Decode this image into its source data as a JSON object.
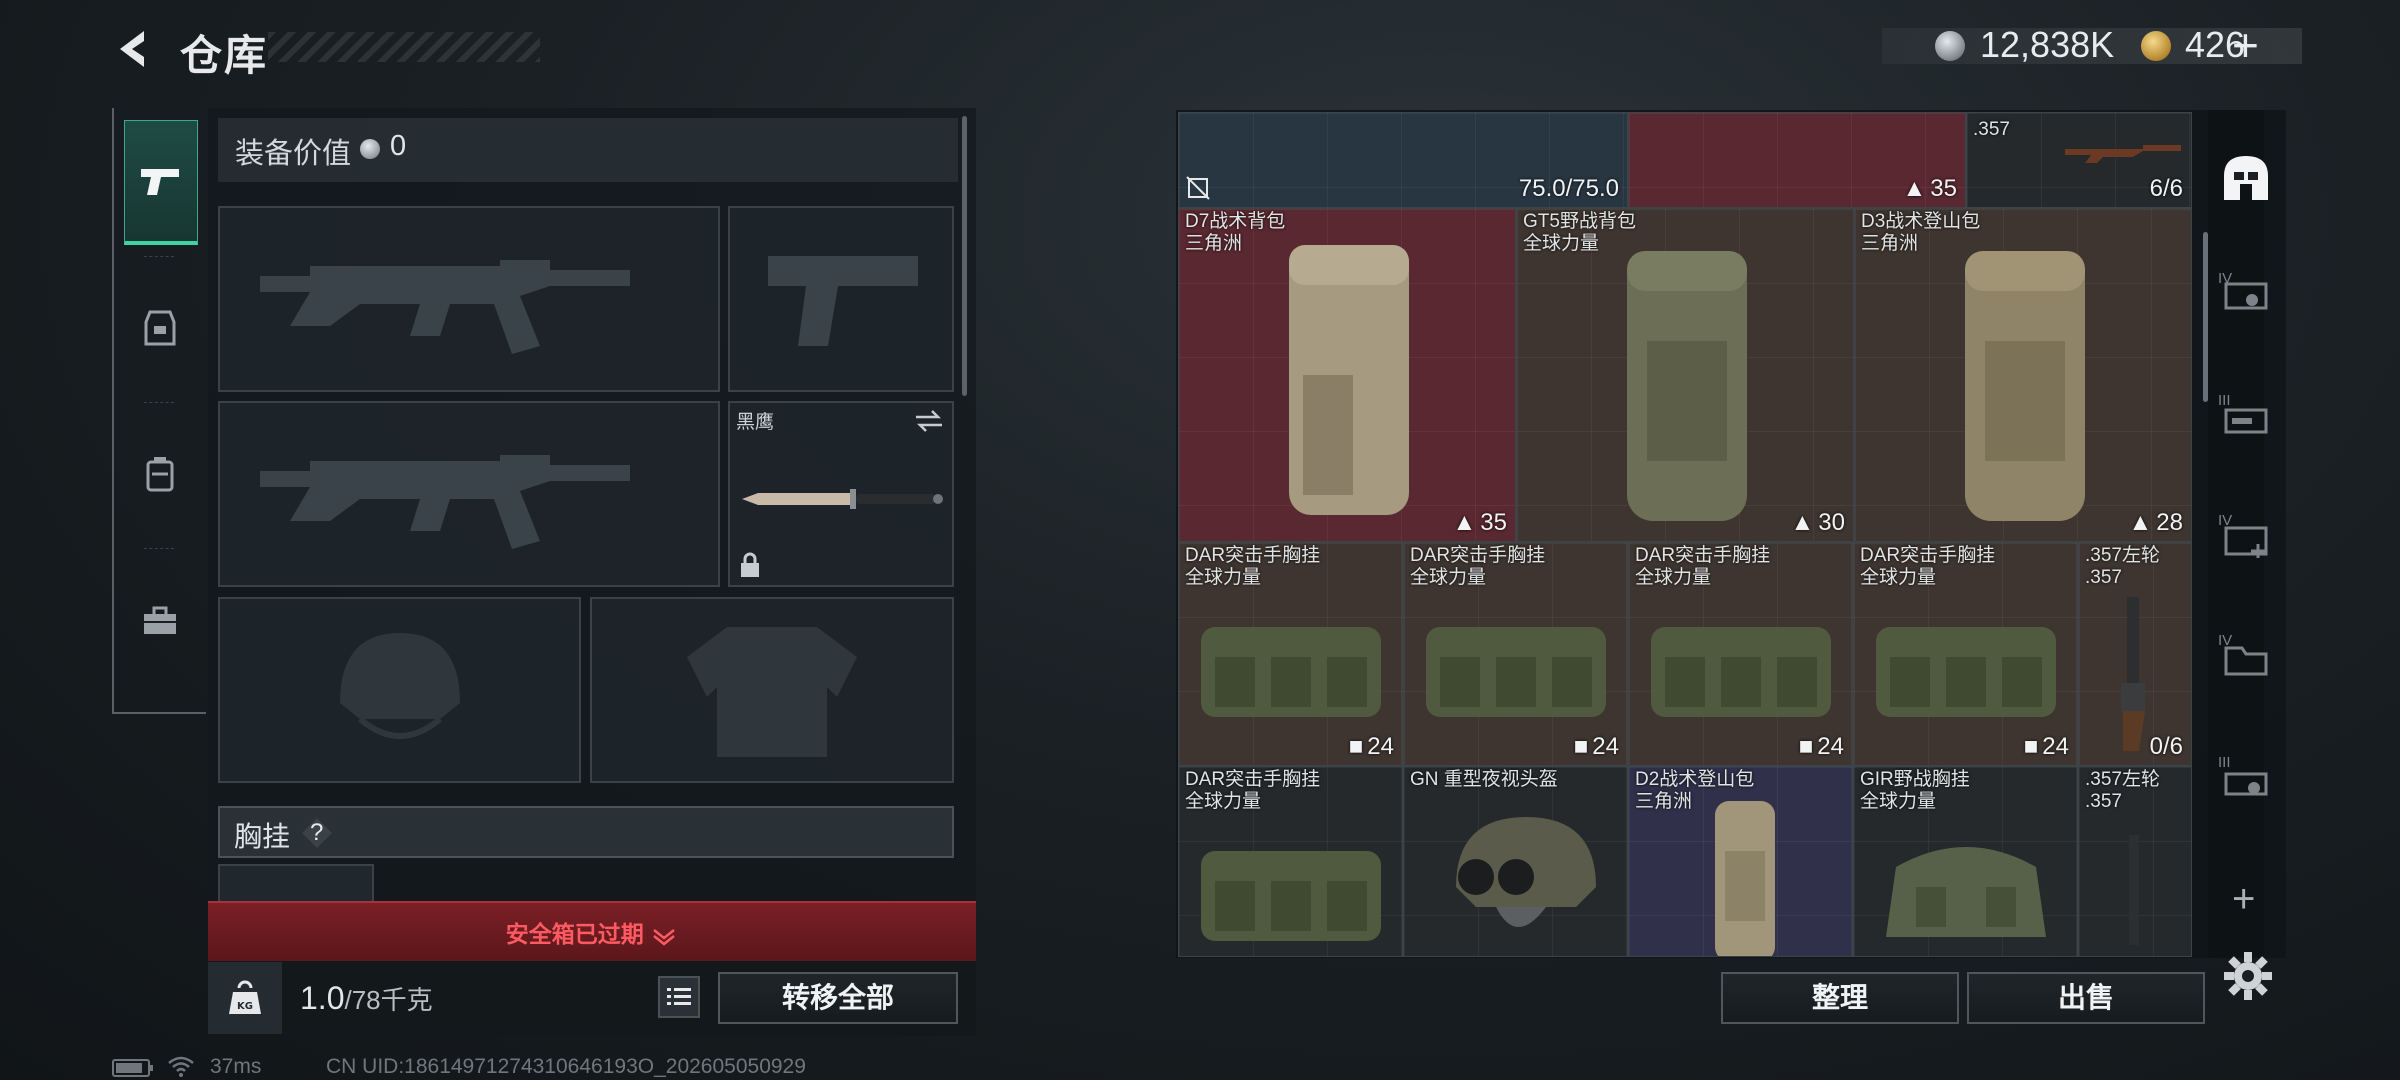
{
  "header": {
    "title": "仓库",
    "silver_amount": "12,838K",
    "gold_amount": "426",
    "plus": "+"
  },
  "loadout": {
    "equip_value_label": "装备价值",
    "equip_value": "0",
    "melee_name": "黑鹰",
    "chest_label": "胸挂",
    "help": "?",
    "safebox_expired": "安全箱已过期",
    "weight_value": "1.0",
    "weight_max": "/78千克",
    "kg_label": "KG",
    "transfer_all": "转移全部"
  },
  "stash": {
    "top_row": [
      {
        "count": "75.0/75.0"
      },
      {
        "count": "35"
      },
      {
        "name": ".357",
        "count": "6/6"
      }
    ],
    "backpacks": [
      {
        "name": "D7战术背包",
        "brand": "三角洲",
        "count": "35"
      },
      {
        "name": "GT5野战背包",
        "brand": "全球力量",
        "count": "30"
      },
      {
        "name": "D3战术登山包",
        "brand": "三角洲",
        "count": "28"
      }
    ],
    "row3": [
      {
        "name": "DAR突击手胸挂",
        "brand": "全球力量",
        "count": "24"
      },
      {
        "name": "DAR突击手胸挂",
        "brand": "全球力量",
        "count": "24"
      },
      {
        "name": "DAR突击手胸挂",
        "brand": "全球力量",
        "count": "24"
      },
      {
        "name": "DAR突击手胸挂",
        "brand": "全球力量",
        "count": "24"
      },
      {
        "name": ".357左轮",
        "brand": ".357",
        "count": "0/6"
      }
    ],
    "row4": [
      {
        "name": "DAR突击手胸挂",
        "brand": "全球力量"
      },
      {
        "name": "GN 重型夜视头盔",
        "brand": ""
      },
      {
        "name": "D2战术登山包",
        "brand": "三角洲"
      },
      {
        "name": "GIR野战胸挂",
        "brand": "全球力量"
      },
      {
        "name": ".357左轮",
        "brand": ".357"
      }
    ],
    "organize": "整理",
    "sell": "出售"
  },
  "side_icons": [
    {
      "label": ""
    },
    {
      "label": "IV"
    },
    {
      "label": "III"
    },
    {
      "label": "IV"
    },
    {
      "label": "IV"
    },
    {
      "label": "III"
    }
  ],
  "add": "+",
  "status": {
    "ping": "37ms",
    "uid": "CN UID:18614971274310646193O_202605050929"
  },
  "colors": {
    "accent_green": "#3fd3a0",
    "warning_red": "#ff5a62",
    "rarity_red": "#5a2830",
    "rarity_brown": "#3e3530"
  }
}
